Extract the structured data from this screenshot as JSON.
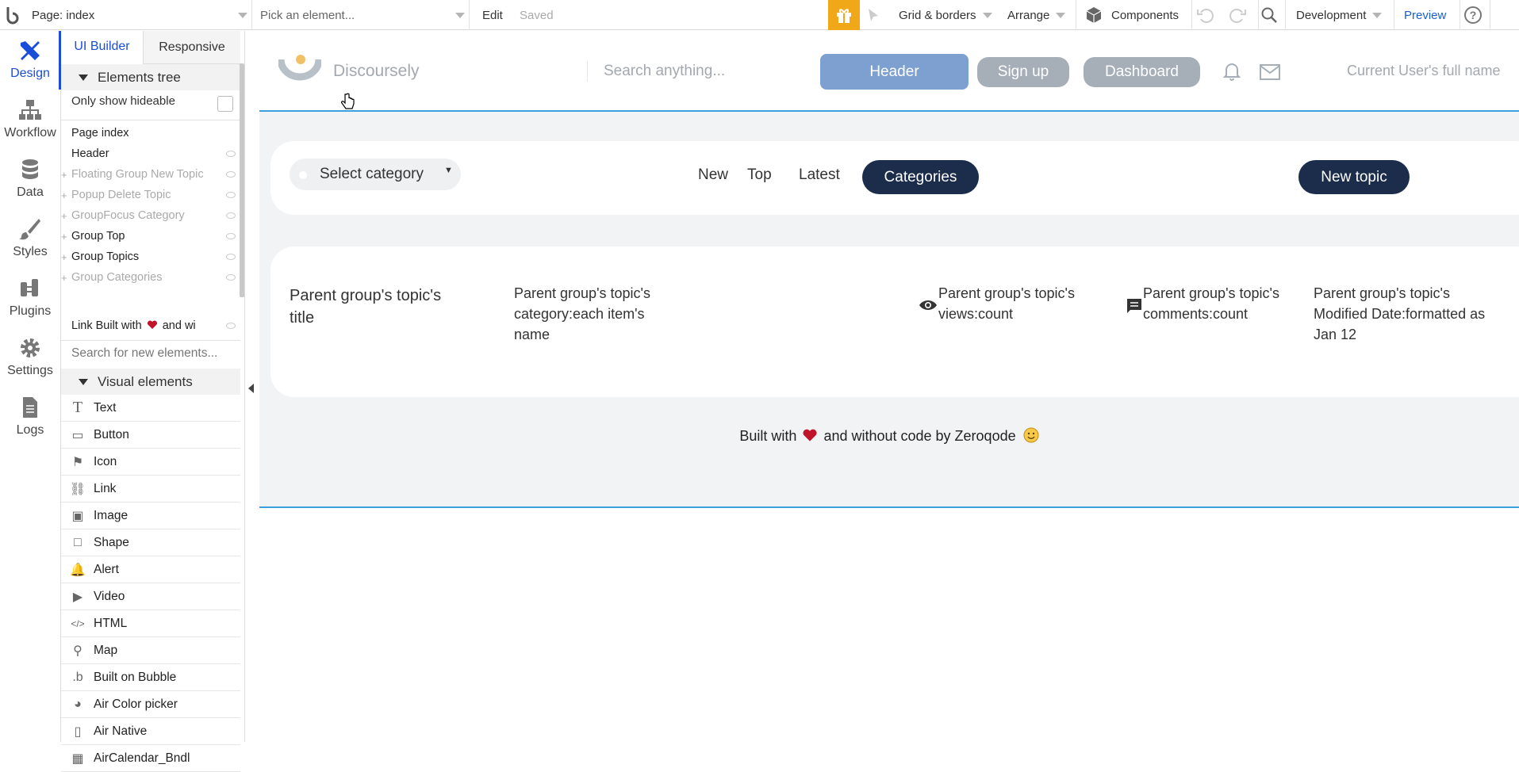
{
  "topbar": {
    "page_select": "Page: index",
    "element_picker": "Pick an element...",
    "edit": "Edit",
    "saved": "Saved",
    "grid_borders": "Grid & borders",
    "arrange": "Arrange",
    "components": "Components",
    "environment": "Development",
    "preview": "Preview",
    "accent_color": "#f0a818"
  },
  "leftnav": [
    {
      "label": "Design",
      "icon": "design-icon"
    },
    {
      "label": "Workflow",
      "icon": "workflow-icon"
    },
    {
      "label": "Data",
      "icon": "database-icon"
    },
    {
      "label": "Styles",
      "icon": "brush-icon"
    },
    {
      "label": "Plugins",
      "icon": "plug-icon"
    },
    {
      "label": "Settings",
      "icon": "gear-icon"
    },
    {
      "label": "Logs",
      "icon": "document-icon"
    }
  ],
  "panel": {
    "tab_ui_builder": "UI Builder",
    "tab_responsive": "Responsive",
    "elements_tree_title": "Elements tree",
    "only_show_hideable": "Only show hideable",
    "tree": [
      {
        "label": "Page index",
        "plus": false,
        "dim": false,
        "eye": false
      },
      {
        "label": "Header",
        "plus": false,
        "dim": false,
        "eye": true
      },
      {
        "label": "Floating Group New Topic",
        "plus": true,
        "dim": true,
        "eye": true
      },
      {
        "label": "Popup Delete Topic",
        "plus": true,
        "dim": true,
        "eye": true
      },
      {
        "label": "GroupFocus Category",
        "plus": true,
        "dim": true,
        "eye": true
      },
      {
        "label": "Group Top",
        "plus": true,
        "dim": false,
        "eye": true
      },
      {
        "label": "Group Topics",
        "plus": true,
        "dim": false,
        "eye": true
      },
      {
        "label": "Group Categories",
        "plus": true,
        "dim": true,
        "eye": true
      }
    ],
    "link_item_prefix": "Link Built with",
    "link_item_suffix": "and wi",
    "search_placeholder": "Search for new elements...",
    "visual_elements_title": "Visual elements",
    "visual_elements": [
      {
        "label": "Text",
        "icon": "text-icon"
      },
      {
        "label": "Button",
        "icon": "button-icon"
      },
      {
        "label": "Icon",
        "icon": "flag-icon"
      },
      {
        "label": "Link",
        "icon": "link-icon"
      },
      {
        "label": "Image",
        "icon": "image-icon"
      },
      {
        "label": "Shape",
        "icon": "shape-icon"
      },
      {
        "label": "Alert",
        "icon": "bell-icon"
      },
      {
        "label": "Video",
        "icon": "video-icon"
      },
      {
        "label": "HTML",
        "icon": "code-icon"
      },
      {
        "label": "Map",
        "icon": "map-pin-icon"
      },
      {
        "label": "Built on Bubble",
        "icon": "bubble-logo-icon"
      },
      {
        "label": "Air Color picker",
        "icon": "palette-icon"
      },
      {
        "label": "Air Native",
        "icon": "phone-icon"
      },
      {
        "label": "AirCalendar_Bndl",
        "icon": "calendar-icon"
      }
    ]
  },
  "canvas": {
    "header": {
      "brand": "Discoursely",
      "search_placeholder": "Search anything...",
      "header_button": "Header",
      "signup_button": "Sign up",
      "dashboard_button": "Dashboard",
      "user_name": "Current User's full name"
    },
    "filters": {
      "select_category": "Select category",
      "tab_new": "New",
      "tab_top": "Top",
      "tab_latest": "Latest",
      "tab_categories": "Categories",
      "new_topic": "New topic"
    },
    "topic": {
      "title": "Parent group's topic's title",
      "category": "Parent group's topic's category:each item's name",
      "views": "Parent group's topic's views:count",
      "comments": "Parent group's topic's comments:count",
      "modified": "Parent group's topic's Modified Date:formatted as Jan 12"
    },
    "footer_prefix": "Built with",
    "footer_suffix": "and without code by Zeroqode",
    "colors": {
      "navy": "#1b2d4b",
      "header_btn": "#7ea0d0",
      "grey_btn": "#a6afb8",
      "line": "#3aa0e0"
    }
  }
}
